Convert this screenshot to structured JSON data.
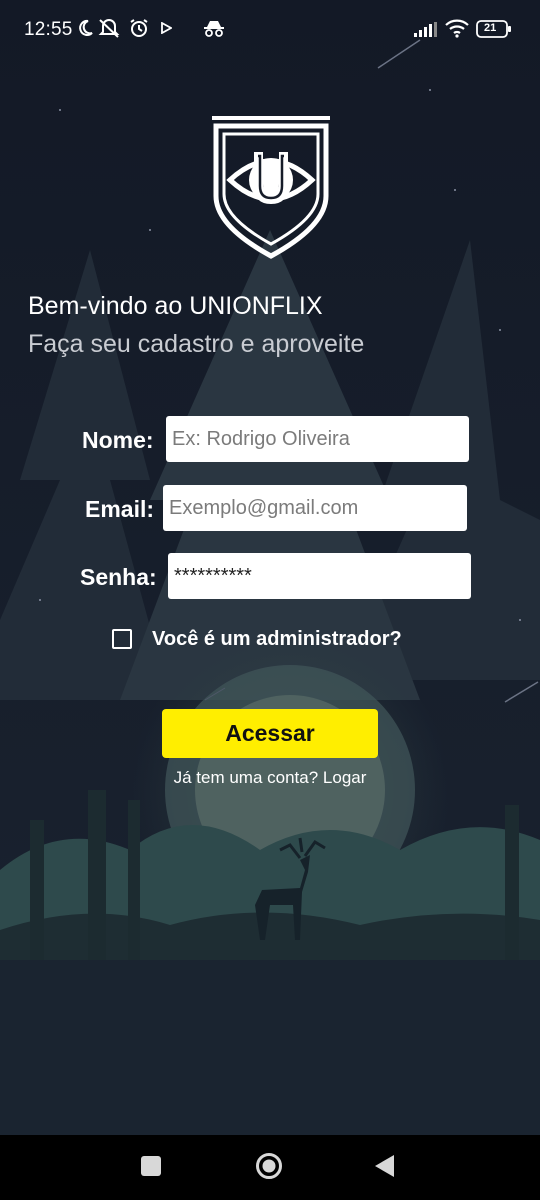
{
  "status_bar": {
    "time": "12:55",
    "battery_level": "21",
    "left_icons": [
      "moon-icon",
      "mute-icon",
      "alarm-icon",
      "play-icon",
      "incognito-icon"
    ],
    "right_icons": [
      "signal-icon",
      "wifi-icon",
      "battery-icon"
    ]
  },
  "header": {
    "logo_icon": "unionflix-shield-logo",
    "title": "Bem-vindo ao UNIONFLIX",
    "subtitle": "Faça seu cadastro e aproveite"
  },
  "form": {
    "name_label": "Nome:",
    "name_placeholder": "Ex: Rodrigo Oliveira",
    "name_value": "",
    "email_label": "Email:",
    "email_placeholder": "Exemplo@gmail.com",
    "email_value": "",
    "password_label": "Senha:",
    "password_value": "**********",
    "admin_checkbox_label": "Você é um administrador?",
    "admin_checked": false,
    "submit_label": "Acessar",
    "login_link": "Já tem uma conta? Logar"
  },
  "colors": {
    "background": "#161c29",
    "accent_button": "#ffee00",
    "text_primary": "#ffffff",
    "text_secondary": "#c9ccd2"
  },
  "nav_bar": {
    "buttons": [
      "recents-square-icon",
      "home-circle-icon",
      "back-triangle-icon"
    ]
  }
}
